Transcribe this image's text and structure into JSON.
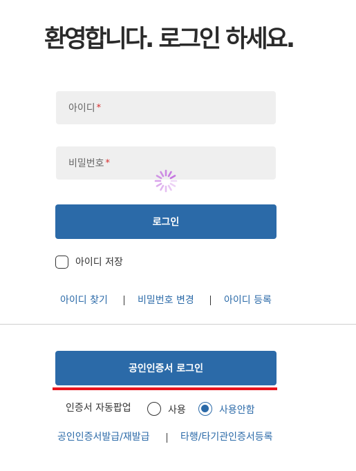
{
  "heading": "환영합니다. 로그인 하세요.",
  "fields": {
    "id_placeholder": "아이디",
    "pw_placeholder": "비밀번호",
    "required_mark": "*"
  },
  "login_button": "로그인",
  "remember_id": {
    "label": "아이디 저장",
    "checked": false
  },
  "links": {
    "find_id": "아이디 찾기",
    "change_password": "비밀번호 변경",
    "register_id": "아이디 등록"
  },
  "cert_login_button": "공인인증서 로그인",
  "cert_popup": {
    "label": "인증서 자동팝업",
    "options": [
      {
        "label": "사용",
        "selected": false
      },
      {
        "label": "사용안함",
        "selected": true
      }
    ]
  },
  "bottom_links": {
    "issue": "공인인증서발급/재발급",
    "register_other": "타행/타기관인증서등록"
  },
  "colors": {
    "primary": "#2b6aa8",
    "accent_line": "#e8141c",
    "required": "#d62b2b",
    "field_bg": "#efefef",
    "spinner": "#c36ee0"
  }
}
